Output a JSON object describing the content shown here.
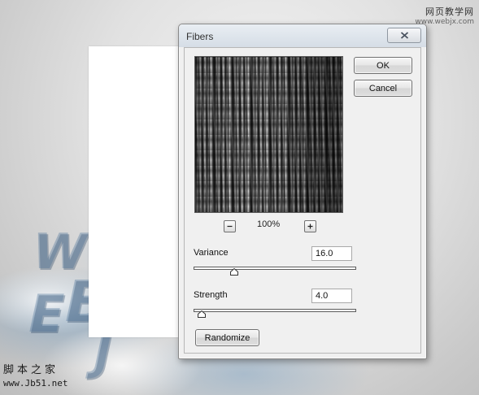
{
  "watermark_top": {
    "line1": "网页教学网",
    "line2": "www.webjx.com"
  },
  "watermark_bottom": {
    "line1": "脚本之家",
    "line2": "www.Jb51.net"
  },
  "background_letters": [
    "W",
    "E",
    "B",
    "J"
  ],
  "dialog": {
    "title": "Fibers",
    "ok_label": "OK",
    "cancel_label": "Cancel",
    "zoom_out_symbol": "−",
    "zoom_in_symbol": "+",
    "zoom_level": "100%",
    "variance_label": "Variance",
    "variance_value": "16.0",
    "variance_level": 0.25,
    "strength_label": "Strength",
    "strength_value": "4.0",
    "strength_level": 0.05,
    "randomize_label": "Randomize"
  },
  "icons": {
    "close": "close-icon"
  },
  "colors": {
    "dialog_bg": "#f0f0f0",
    "canvas": "#ffffff"
  }
}
